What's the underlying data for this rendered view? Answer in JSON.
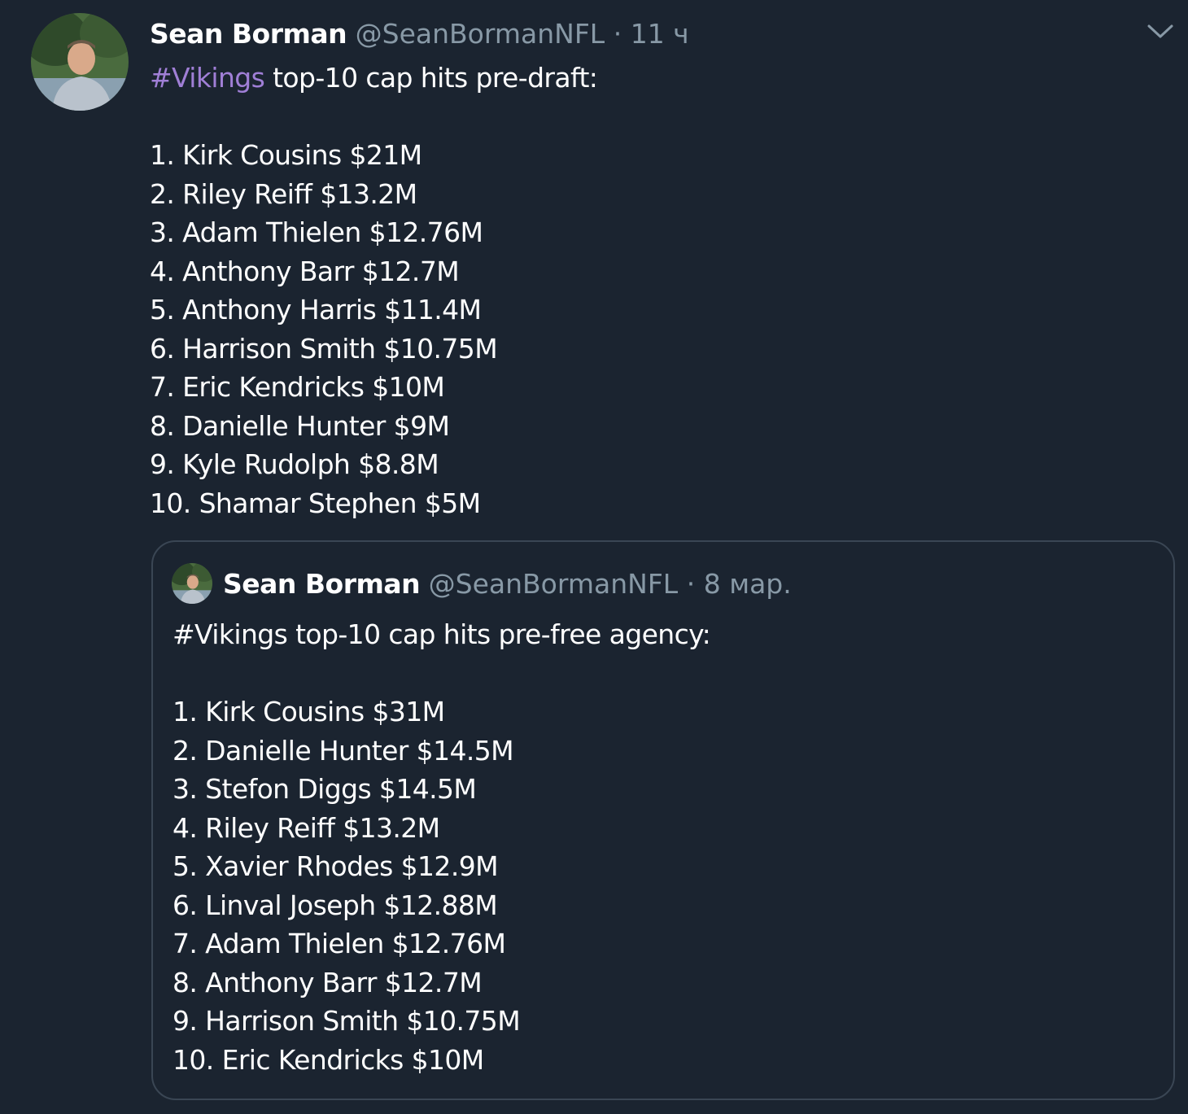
{
  "tweet": {
    "author_name": "Sean Borman",
    "author_handle": "@SeanBormanNFL",
    "separator": "·",
    "time": "11 ч",
    "hashtag": "#Vikings",
    "text_intro": " top-10 cap hits pre-draft:",
    "list": [
      "1. Kirk Cousins $21M",
      "2. Riley Reiff $13.2M",
      "3. Adam Thielen $12.76M",
      "4. Anthony Barr $12.7M",
      "5. Anthony Harris $11.4M",
      "6. Harrison Smith $10.75M",
      "7. Eric Kendricks $10M",
      "8. Danielle Hunter $9M",
      "9. Kyle Rudolph $8.8M",
      "10. Shamar Stephen $5M"
    ],
    "menu_icon": "chevron-down-icon"
  },
  "quoted_tweet": {
    "author_name": "Sean Borman",
    "author_handle": "@SeanBormanNFL",
    "separator": "·",
    "time": "8 мар.",
    "text_intro": "#Vikings top-10 cap hits pre-free agency:",
    "list": [
      "1. Kirk Cousins $31M",
      "2. Danielle Hunter $14.5M",
      "3. Stefon Diggs $14.5M",
      "4. Riley Reiff $13.2M",
      "5. Xavier Rhodes $12.9M",
      "6. Linval Joseph $12.88M",
      "7. Adam Thielen $12.76M",
      "8. Anthony Barr $12.7M",
      "9. Harrison Smith $10.75M",
      "10. Eric Kendricks $10M"
    ]
  },
  "colors": {
    "background": "#1b2430",
    "hashtag": "#a07fd6",
    "muted": "#8899a6",
    "border": "#3a4654"
  }
}
